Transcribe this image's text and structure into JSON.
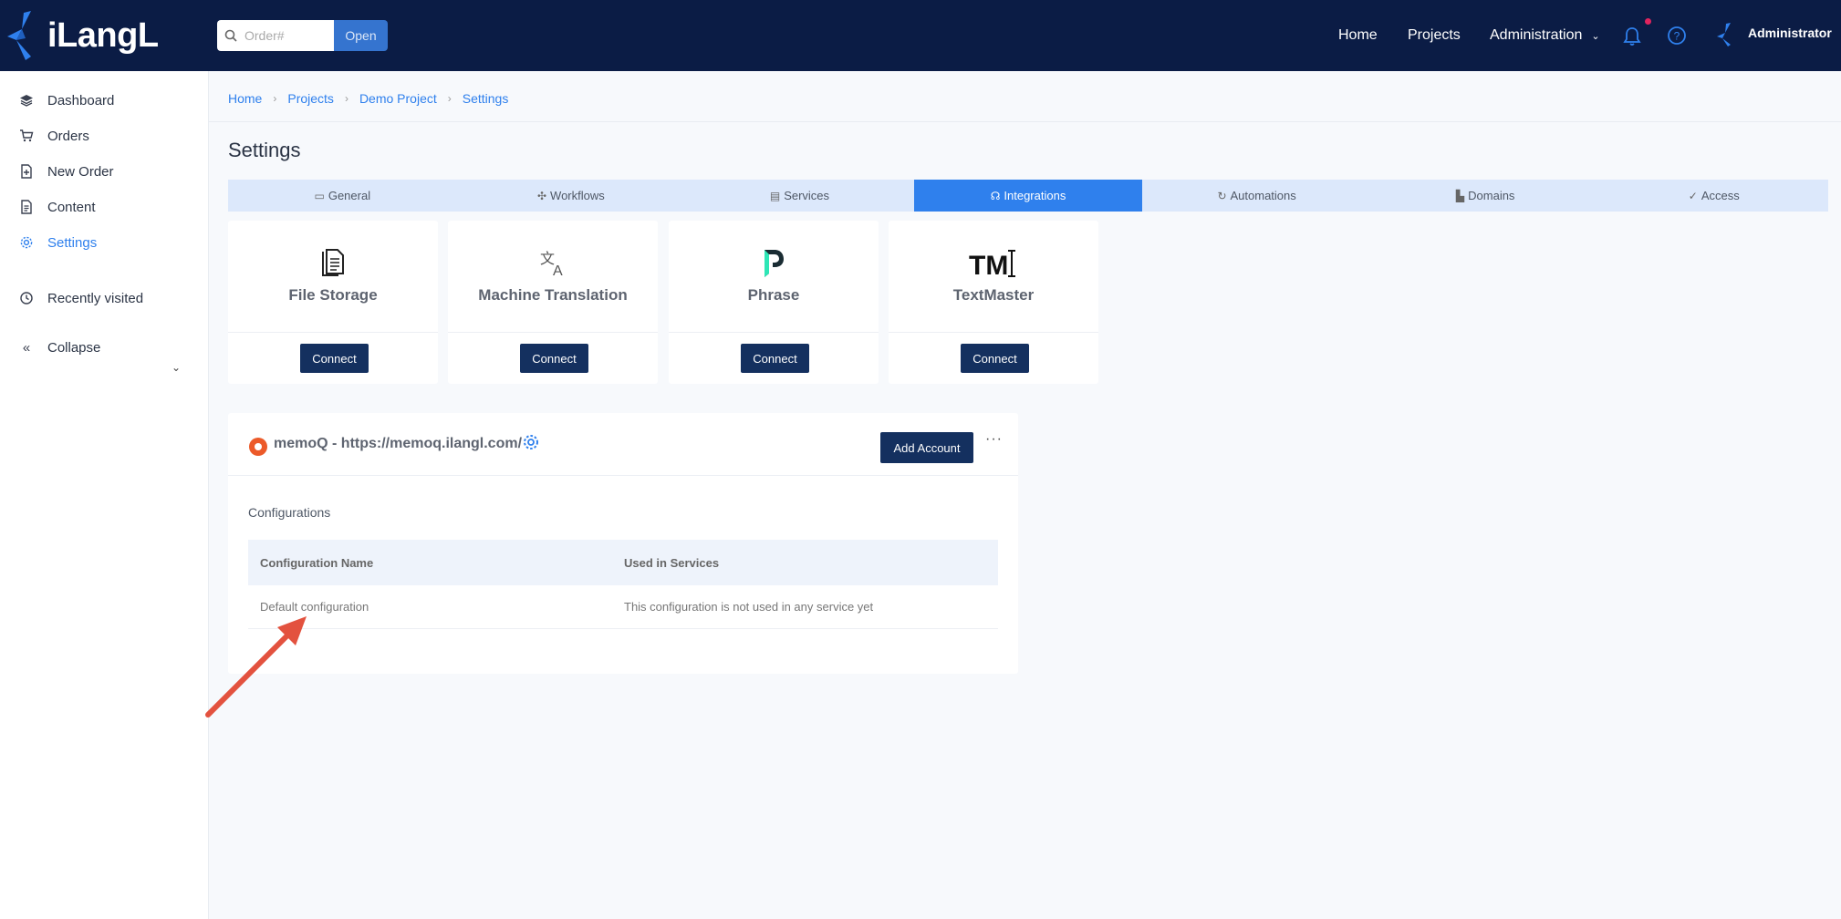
{
  "header": {
    "logo_text": "iLangL",
    "search_placeholder": "Order#",
    "open_label": "Open",
    "nav": {
      "home": "Home",
      "projects": "Projects",
      "administration": "Administration"
    },
    "user_name": "Administrator"
  },
  "sidebar": {
    "items": [
      {
        "label": "Dashboard",
        "icon": "layers-icon"
      },
      {
        "label": "Orders",
        "icon": "cart-icon"
      },
      {
        "label": "New Order",
        "icon": "new-document-icon"
      },
      {
        "label": "Content",
        "icon": "document-icon"
      },
      {
        "label": "Settings",
        "icon": "gear-icon",
        "active": true
      }
    ],
    "recently_visited": "Recently visited",
    "collapse": "Collapse"
  },
  "breadcrumb": [
    "Home",
    "Projects",
    "Demo Project",
    "Settings"
  ],
  "page_title": "Settings",
  "tabs": [
    {
      "label": "General",
      "icon": "monitor-icon"
    },
    {
      "label": "Workflows",
      "icon": "workflow-icon"
    },
    {
      "label": "Services",
      "icon": "server-icon"
    },
    {
      "label": "Integrations",
      "icon": "plug-icon",
      "active": true
    },
    {
      "label": "Automations",
      "icon": "refresh-icon"
    },
    {
      "label": "Domains",
      "icon": "folder-icon"
    },
    {
      "label": "Access",
      "icon": "shield-check-icon"
    }
  ],
  "integrations": [
    {
      "title": "File Storage",
      "button": "Connect",
      "icon": "file-storage-icon"
    },
    {
      "title": "Machine Translation",
      "button": "Connect",
      "icon": "translate-icon"
    },
    {
      "title": "Phrase",
      "button": "Connect",
      "icon": "phrase-logo"
    },
    {
      "title": "TextMaster",
      "button": "Connect",
      "icon": "textmaster-logo",
      "logo_text": "TM"
    }
  ],
  "memoq": {
    "title": "memoQ - https://memoq.ilangl.com/",
    "add_account": "Add Account",
    "more": "···",
    "configurations_label": "Configurations",
    "columns": [
      "Configuration Name",
      "Used in Services"
    ],
    "rows": [
      {
        "name": "Default configuration",
        "services": "This configuration is not used in any service yet"
      }
    ]
  },
  "colors": {
    "topbar": "#0b1c45",
    "accent": "#2f80ed",
    "button_dark": "#14305f",
    "arrow": "#e3523f"
  }
}
